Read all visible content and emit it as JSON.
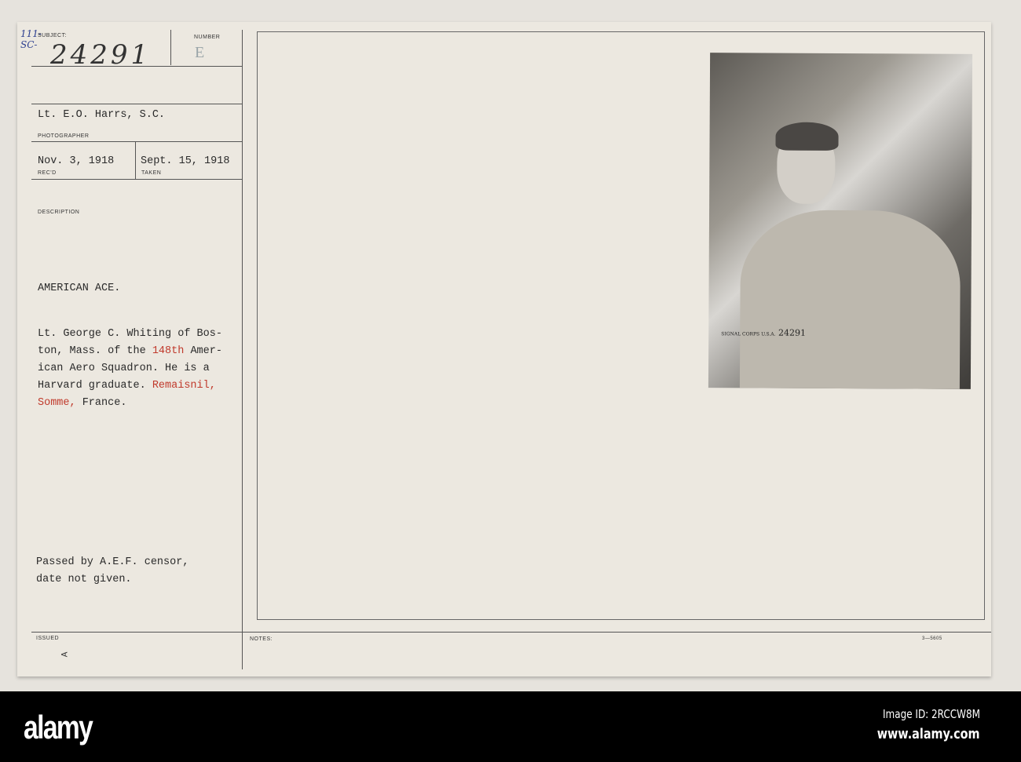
{
  "card": {
    "subject_label": "SUBJECT:",
    "subject_prefix_handwritten": "111-\nSC-",
    "subject_number_handwritten": "24291",
    "number_label": "NUMBER",
    "number_value": "E",
    "photographer": "Lt. E.O. Harrs, S.C.",
    "photographer_label": "PHOTOGRAPHER",
    "received": "Nov. 3, 1918",
    "received_label": "REC'D",
    "taken": "Sept. 15, 1918",
    "taken_label": "TAKEN",
    "description_label": "DESCRIPTION",
    "heading": "AMERICAN ACE.",
    "desc_lines": [
      [
        "Lt. George C. Whiting of Bos-"
      ],
      [
        "ton, Mass. of the ",
        "148th",
        " Amer-"
      ],
      [
        "ican Aero Squadron. He is a"
      ],
      [
        "Harvard graduate. ",
        "Remaisnil,",
        ""
      ],
      [
        "",
        "Somme,",
        " France."
      ]
    ],
    "censor_lines": [
      "Passed by A.E.F. censor,",
      "date not given."
    ],
    "issued_label": "ISSUED",
    "issued_mark": "A",
    "notes_label": "NOTES:",
    "form_number": "3—5605",
    "photo_stamp": "SIGNAL CORPS U.S.A.",
    "photo_number": "24291"
  },
  "footer": {
    "logo": "alamy",
    "image_id": "Image ID: 2RCCW8M",
    "url": "www.alamy.com"
  }
}
